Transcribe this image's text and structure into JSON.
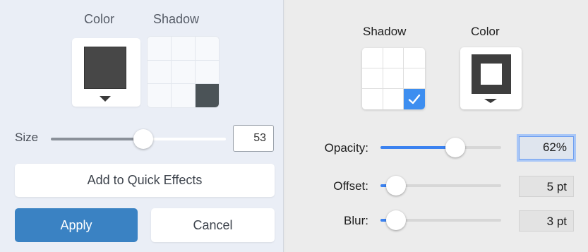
{
  "left_panel": {
    "color_label": "Color",
    "shadow_label": "Shadow",
    "shadow_grid_selected": 8,
    "size_label": "Size",
    "size_value": "53",
    "size_fraction": 0.53,
    "add_quick_effects_label": "Add to Quick Effects",
    "apply_label": "Apply",
    "cancel_label": "Cancel",
    "swatch_color": "#474747",
    "accent": "#3a82c3"
  },
  "right_panel": {
    "shadow_label": "Shadow",
    "color_label": "Color",
    "shadow_grid_checked": 8,
    "opacity_label": "Opacity:",
    "opacity_value": "62%",
    "opacity_fraction": 0.62,
    "offset_label": "Offset:",
    "offset_value": "5 pt",
    "offset_fraction": 0.0,
    "blur_label": "Blur:",
    "blur_value": "3 pt",
    "blur_fraction": 0.0,
    "accent": "#3b82f0",
    "checkmark_icon": "checkmark-icon"
  }
}
